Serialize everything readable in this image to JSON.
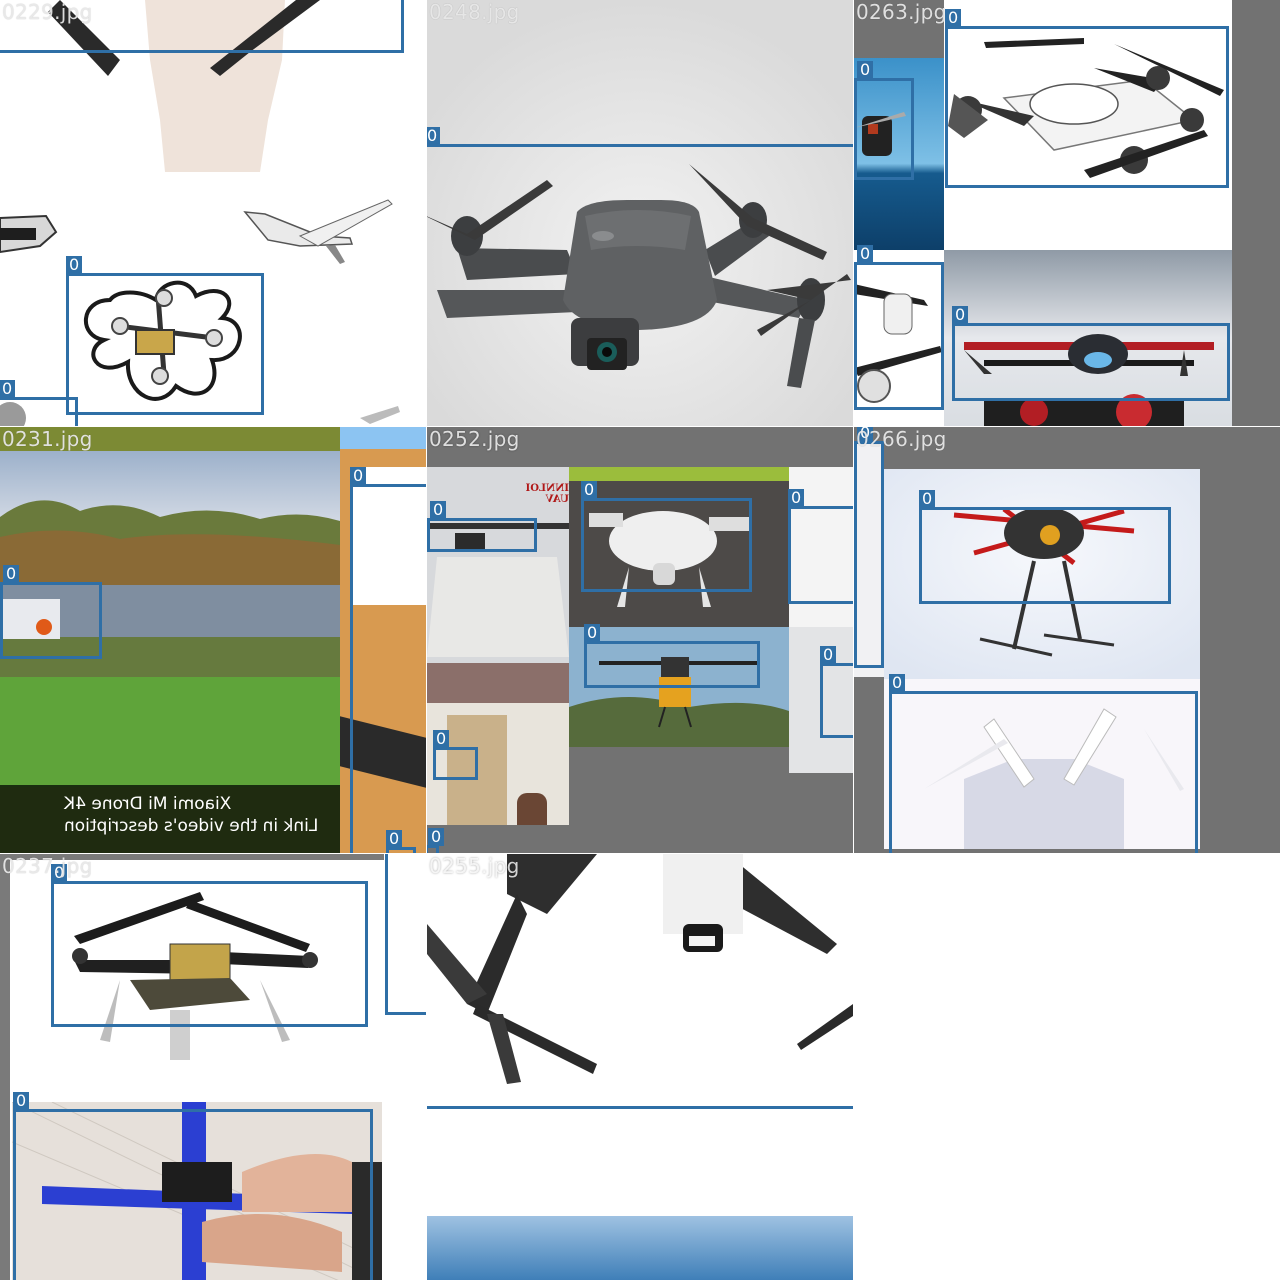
{
  "grid": {
    "tiles": [
      {
        "filename": "0229.jpg",
        "boxes": [
          {
            "label": "0"
          },
          {
            "label": "0"
          },
          {
            "label": "0"
          }
        ]
      },
      {
        "filename": "0248.jpg",
        "boxes": [
          {
            "label": "0"
          }
        ]
      },
      {
        "filename": "0263.jpg",
        "boxes": [
          {
            "label": "0"
          },
          {
            "label": "0"
          },
          {
            "label": "0"
          },
          {
            "label": "0"
          }
        ]
      },
      {
        "filename": "0231.jpg",
        "boxes": [
          {
            "label": "0"
          },
          {
            "label": "0"
          },
          {
            "label": "0"
          }
        ],
        "caption_line1": "Xiaomi Mi Drone 4K",
        "caption_line2": "Link in the video's description"
      },
      {
        "filename": "0252.jpg",
        "boxes": [
          {
            "label": "0"
          },
          {
            "label": "0"
          },
          {
            "label": "0"
          },
          {
            "label": "0"
          },
          {
            "label": "0"
          },
          {
            "label": "0"
          },
          {
            "label": "0"
          }
        ],
        "banner_text": "INNLOI UAV"
      },
      {
        "filename": "0266.jpg",
        "boxes": [
          {
            "label": "0"
          },
          {
            "label": "0"
          },
          {
            "label": "0"
          }
        ]
      },
      {
        "filename": "0237.jpg",
        "boxes": [
          {
            "label": "0"
          },
          {
            "label": "0"
          },
          {
            "label": "0"
          }
        ]
      },
      {
        "filename": "0255.jpg",
        "boxes": [
          {
            "label": "0"
          }
        ]
      }
    ]
  },
  "colors": {
    "box": "#2f6fa6",
    "pad_gray": "#727272",
    "background": "#ffffff"
  }
}
